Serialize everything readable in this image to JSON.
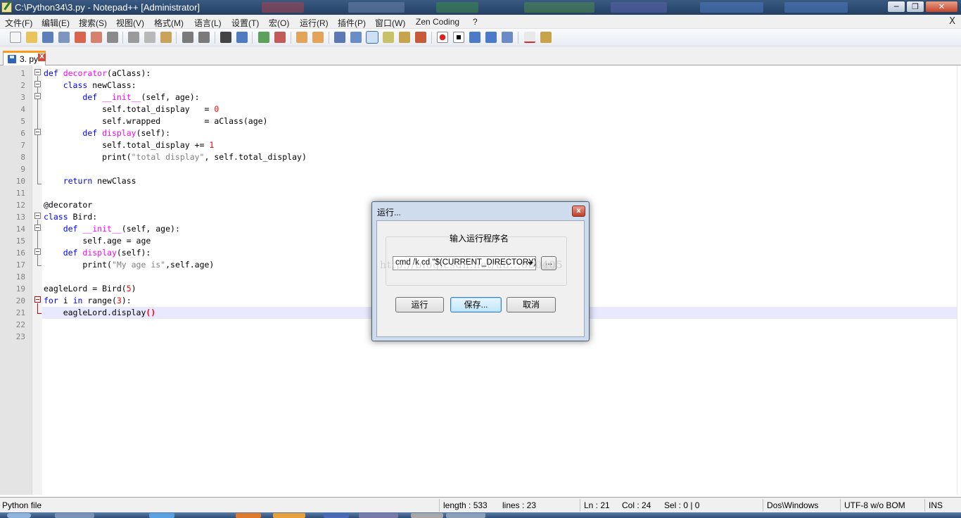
{
  "window": {
    "title": "C:\\Python34\\3.py - Notepad++ [Administrator]",
    "minimize_glyph": "─",
    "maximize_glyph": "❐",
    "close_glyph": "✕"
  },
  "menu": {
    "items": [
      "文件(F)",
      "编辑(E)",
      "搜索(S)",
      "视图(V)",
      "格式(M)",
      "语言(L)",
      "设置(T)",
      "宏(O)",
      "运行(R)",
      "插件(P)",
      "窗口(W)",
      "Zen Coding",
      "?"
    ],
    "close_doc_glyph": "X"
  },
  "toolbar": {
    "icons": [
      "new-file-icon",
      "open-file-icon",
      "save-icon",
      "save-all-icon",
      "close-icon",
      "close-all-icon",
      "print-icon",
      "cut-icon",
      "copy-icon",
      "paste-icon",
      "undo-icon",
      "redo-icon",
      "find-icon",
      "replace-icon",
      "zoom-in-icon",
      "zoom-out-icon",
      "sync-v-icon",
      "sync-h-icon",
      "word-wrap-icon",
      "show-all-chars-icon",
      "indent-guide-icon",
      "user-lang-icon",
      "doc-map-icon",
      "function-list-icon",
      "record-macro-icon",
      "stop-macro-icon",
      "play-macro-icon",
      "run-macro-multi-icon",
      "save-macro-icon",
      "spellcheck-icon",
      "plugin-icon"
    ]
  },
  "tabs": [
    {
      "label": "3. py",
      "close_glyph": "X"
    }
  ],
  "editor": {
    "line_numbers": [
      "1",
      "2",
      "3",
      "4",
      "5",
      "6",
      "7",
      "8",
      "9",
      "10",
      "11",
      "12",
      "13",
      "14",
      "15",
      "16",
      "17",
      "18",
      "19",
      "20",
      "21",
      "22",
      "23"
    ],
    "lines": [
      [
        {
          "t": "def ",
          "c": "kw"
        },
        {
          "t": "decorator",
          "c": "fn"
        },
        {
          "t": "(aClass):",
          "c": ""
        }
      ],
      [
        {
          "t": "    ",
          "c": ""
        },
        {
          "t": "class ",
          "c": "kw"
        },
        {
          "t": "newClass:",
          "c": ""
        }
      ],
      [
        {
          "t": "        ",
          "c": ""
        },
        {
          "t": "def ",
          "c": "kw"
        },
        {
          "t": "__init__",
          "c": "fn"
        },
        {
          "t": "(self, age):",
          "c": ""
        }
      ],
      [
        {
          "t": "            self.total_display   = ",
          "c": ""
        },
        {
          "t": "0",
          "c": "num"
        }
      ],
      [
        {
          "t": "            self.wrapped         = aClass(age)",
          "c": ""
        }
      ],
      [
        {
          "t": "        ",
          "c": ""
        },
        {
          "t": "def ",
          "c": "kw"
        },
        {
          "t": "display",
          "c": "fn"
        },
        {
          "t": "(self):",
          "c": ""
        }
      ],
      [
        {
          "t": "            self.total_display += ",
          "c": ""
        },
        {
          "t": "1",
          "c": "num"
        }
      ],
      [
        {
          "t": "            print(",
          "c": ""
        },
        {
          "t": "\"total display\"",
          "c": "str"
        },
        {
          "t": ", self.total_display)",
          "c": ""
        }
      ],
      [],
      [
        {
          "t": "    ",
          "c": ""
        },
        {
          "t": "return ",
          "c": "kw"
        },
        {
          "t": "newClass",
          "c": ""
        }
      ],
      [],
      [
        {
          "t": "@decorator",
          "c": ""
        }
      ],
      [
        {
          "t": "class ",
          "c": "kw"
        },
        {
          "t": "Bird:",
          "c": ""
        }
      ],
      [
        {
          "t": "    ",
          "c": ""
        },
        {
          "t": "def ",
          "c": "kw"
        },
        {
          "t": "__init__",
          "c": "fn"
        },
        {
          "t": "(self, age):",
          "c": ""
        }
      ],
      [
        {
          "t": "        self.age = age",
          "c": ""
        }
      ],
      [
        {
          "t": "    ",
          "c": ""
        },
        {
          "t": "def ",
          "c": "kw"
        },
        {
          "t": "display",
          "c": "fn"
        },
        {
          "t": "(self):",
          "c": ""
        }
      ],
      [
        {
          "t": "        print(",
          "c": ""
        },
        {
          "t": "\"My age is\"",
          "c": "str"
        },
        {
          "t": ",self.age)",
          "c": ""
        }
      ],
      [],
      [
        {
          "t": "eagleLord = Bird(",
          "c": ""
        },
        {
          "t": "5",
          "c": "num"
        },
        {
          "t": ")",
          "c": ""
        }
      ],
      [
        {
          "t": "for ",
          "c": "kw"
        },
        {
          "t": "i ",
          "c": ""
        },
        {
          "t": "in ",
          "c": "kw"
        },
        {
          "t": "range(",
          "c": ""
        },
        {
          "t": "3",
          "c": "num"
        },
        {
          "t": "):",
          "c": ""
        }
      ],
      [
        {
          "t": "    eagleLord.display",
          "c": ""
        },
        {
          "t": "()",
          "c": "brace"
        }
      ],
      [],
      []
    ]
  },
  "run_dialog": {
    "title": "运行...",
    "close_glyph": "x",
    "group_label": "输入运行程序名",
    "command_value": "cmd /k cd \"$(CURRENT_DIRECTORY)\"",
    "browse_label": "...",
    "run_button": "运行",
    "save_button": "保存...",
    "cancel_button": "取消",
    "watermark": "http://blog.csdn.net/u8...680405"
  },
  "status": {
    "lang": "Python file",
    "length": "length : 533",
    "lines": "lines : 23",
    "ln": "Ln : 21",
    "col": "Col : 24",
    "sel": "Sel : 0 | 0",
    "eol": "Dos\\Windows",
    "encoding": "UTF-8 w/o BOM",
    "mode": "INS"
  },
  "colors": {
    "keyword": "#0000ff",
    "function": "#ff00ff",
    "number": "#ff0000",
    "string": "#808080",
    "current_line": "#e8e8ff",
    "tab_accent": "#fa9a1c"
  }
}
